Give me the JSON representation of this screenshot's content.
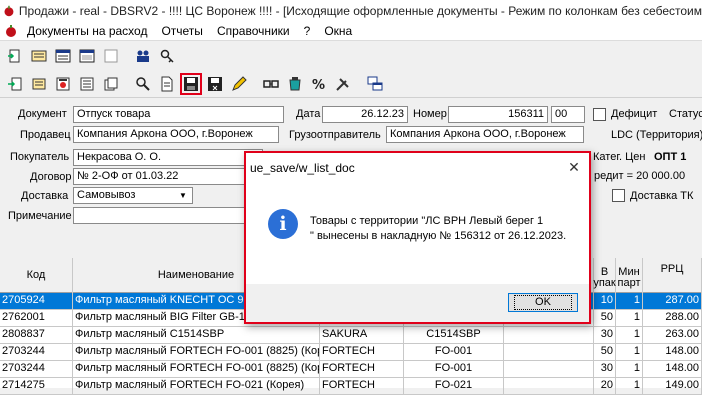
{
  "window": {
    "title": "Продажи - real - DBSRV2   -   !!!! ЦС Воронеж !!!! - [Исходящие оформленные документы - Режим по колонкам без себестоим"
  },
  "menu": [
    "Документы на расход",
    "Отчеты",
    "Справочники",
    "?",
    "Окна"
  ],
  "toolbar1": [
    "doc-new-icon",
    "list-icon",
    "window-icon",
    "window2-icon",
    "blank-icon",
    "users-icon",
    "key-icon"
  ],
  "toolbar2": [
    "doc-add-icon",
    "calc-icon",
    "print-icon",
    "sheet-icon",
    "docs-icon",
    "preview-icon",
    "file-icon",
    "save-icon",
    "save-close-icon",
    "edit-icon",
    "link-icon",
    "bucket-icon",
    "percent-icon",
    "tools-icon",
    "windows-icon"
  ],
  "form": {
    "document_label": "Документ",
    "document_value": "Отпуск товара",
    "date_label": "Дата",
    "date_value": "26.12.23",
    "number_label": "Номер",
    "number_value": "156311",
    "number_suffix": "00",
    "deficit_label": "Дефицит",
    "status_label": "Статус",
    "seller_label": "Продавец",
    "seller_value": "Компания Аркона ООО, г.Воронеж",
    "shipper_label": "Грузоотправитель",
    "shipper_value": "Компания Аркона ООО, г.Воронеж",
    "territory_label": "LDC (Территория)",
    "buyer_label": "Покупатель",
    "buyer_value": "Некрасова О. О.",
    "price_cat_label": "Катег. Цен",
    "price_cat_value": "ОПТ 1",
    "contract_label": "Договор",
    "contract_value": "№ 2-ОФ от 01.03.22",
    "credit_label": "редит = 20 000.00",
    "delivery_label": "Доставка",
    "delivery_value": "Самовывоз",
    "delivery_tk_label": "Доставка ТК",
    "note_label": "Примечание"
  },
  "table": {
    "headers": {
      "code": "Код",
      "name": "Наименование",
      "in_pack": "В упак",
      "min_part": "Мин парт",
      "rrp": "РРЦ"
    },
    "rows": [
      {
        "code": "2705924",
        "name": "Фильтр масляный KNECHT OC 90",
        "brand": "",
        "article": "",
        "qty": "10",
        "min": "1",
        "rrp": "287.00"
      },
      {
        "code": "2762001",
        "name": "Фильтр масляный BIG Filter GB-10",
        "brand": "",
        "article": "",
        "qty": "50",
        "min": "1",
        "rrp": "288.00"
      },
      {
        "code": "2808837",
        "name": "Фильтр масляный C1514SBP",
        "brand": "SAKURA",
        "article": "C1514SBP",
        "qty": "30",
        "min": "1",
        "rrp": "263.00"
      },
      {
        "code": "2703244",
        "name": "Фильтр масляный FORTECH FO-001 (8825) (Корея)",
        "brand": "FORTECH",
        "article": "FO-001",
        "qty": "50",
        "min": "1",
        "rrp": "148.00"
      },
      {
        "code": "2703244",
        "name": "Фильтр масляный FORTECH FO-001 (8825) (Корея)",
        "brand": "FORTECH",
        "article": "FO-001",
        "qty": "30",
        "min": "1",
        "rrp": "148.00"
      },
      {
        "code": "2714275",
        "name": "Фильтр масляный FORTECH FO-021 (Корея)",
        "brand": "FORTECH",
        "article": "FO-021",
        "qty": "20",
        "min": "1",
        "rrp": "149.00"
      }
    ]
  },
  "dialog": {
    "title": "ue_save/w_list_doc",
    "message_line1": "Товары с территории \"ЛС ВРН Левый берег 1",
    "message_line2": "\" вынесены в накладную № 156312 от 26.12.2023.",
    "ok_label": "OK",
    "close_glyph": "✕",
    "icon": "info-icon"
  }
}
